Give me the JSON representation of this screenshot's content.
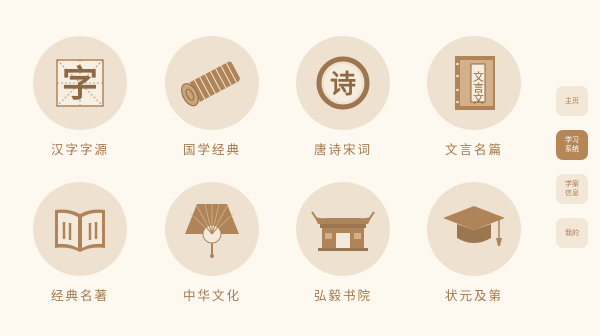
{
  "colors": {
    "background": "#fdf8f0",
    "circle": "#efe1d0",
    "icon": "#b08459",
    "label": "#a5784c",
    "side_active": "#b58756",
    "side": "#f3e7d8"
  },
  "tiles": [
    {
      "label": "汉字字源",
      "icon": "zi-character-icon",
      "glyph": "字"
    },
    {
      "label": "国学经典",
      "icon": "bamboo-scroll-icon"
    },
    {
      "label": "唐诗宋词",
      "icon": "shi-seal-icon",
      "glyph": "诗"
    },
    {
      "label": "文言名篇",
      "icon": "thread-bound-book-icon",
      "glyph": "文言文"
    },
    {
      "label": "经典名著",
      "icon": "open-book-icon"
    },
    {
      "label": "中华文化",
      "icon": "folding-fan-icon"
    },
    {
      "label": "弘毅书院",
      "icon": "academy-gate-icon"
    },
    {
      "label": "状元及第",
      "icon": "graduation-cap-icon"
    }
  ],
  "sidebar": [
    {
      "label": "主页",
      "active": false
    },
    {
      "label": "学习\n系统",
      "active": true
    },
    {
      "label": "学案\n信息",
      "active": false
    },
    {
      "label": "我的",
      "active": false
    }
  ]
}
